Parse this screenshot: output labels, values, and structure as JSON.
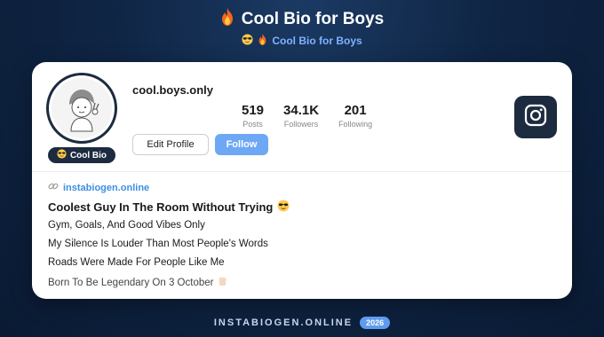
{
  "header": {
    "title": "Cool Bio for Boys",
    "subtitle": "Cool Bio for Boys",
    "title_icon": "fire-icon",
    "subtitle_icons": [
      "sunglasses-face-icon",
      "fire-icon"
    ]
  },
  "profile": {
    "username": "cool.boys.only",
    "badge_label": "Cool Bio",
    "badge_icon": "sunglasses-face-icon",
    "stats": [
      {
        "value": "519",
        "label": "Posts"
      },
      {
        "value": "34.1K",
        "label": "Followers"
      },
      {
        "value": "201",
        "label": "Following"
      }
    ],
    "edit_label": "Edit Profile",
    "follow_label": "Follow",
    "instagram_icon": "instagram-icon"
  },
  "bio": {
    "link": "instabiogen.online",
    "link_icon": "link-icon",
    "headline": "Coolest Guy In The Room Without Trying",
    "headline_icon": "sunglasses-face-icon",
    "lines": [
      "Gym, Goals, And Good Vibes Only",
      "My Silence Is Louder Than Most People's Words",
      "Roads Were Made For People Like Me",
      "Born To Be Legendary On 3 October"
    ],
    "last_line_icon": "raised-fist-icon"
  },
  "footer": {
    "site": "INSTABIOGEN.ONLINE",
    "year": "2026"
  },
  "colors": {
    "background": "#0f2544",
    "card": "#ffffff",
    "accent_blue": "#6ea8f4",
    "link_blue": "#3f8ee0",
    "dark_navy": "#1d2b40"
  }
}
